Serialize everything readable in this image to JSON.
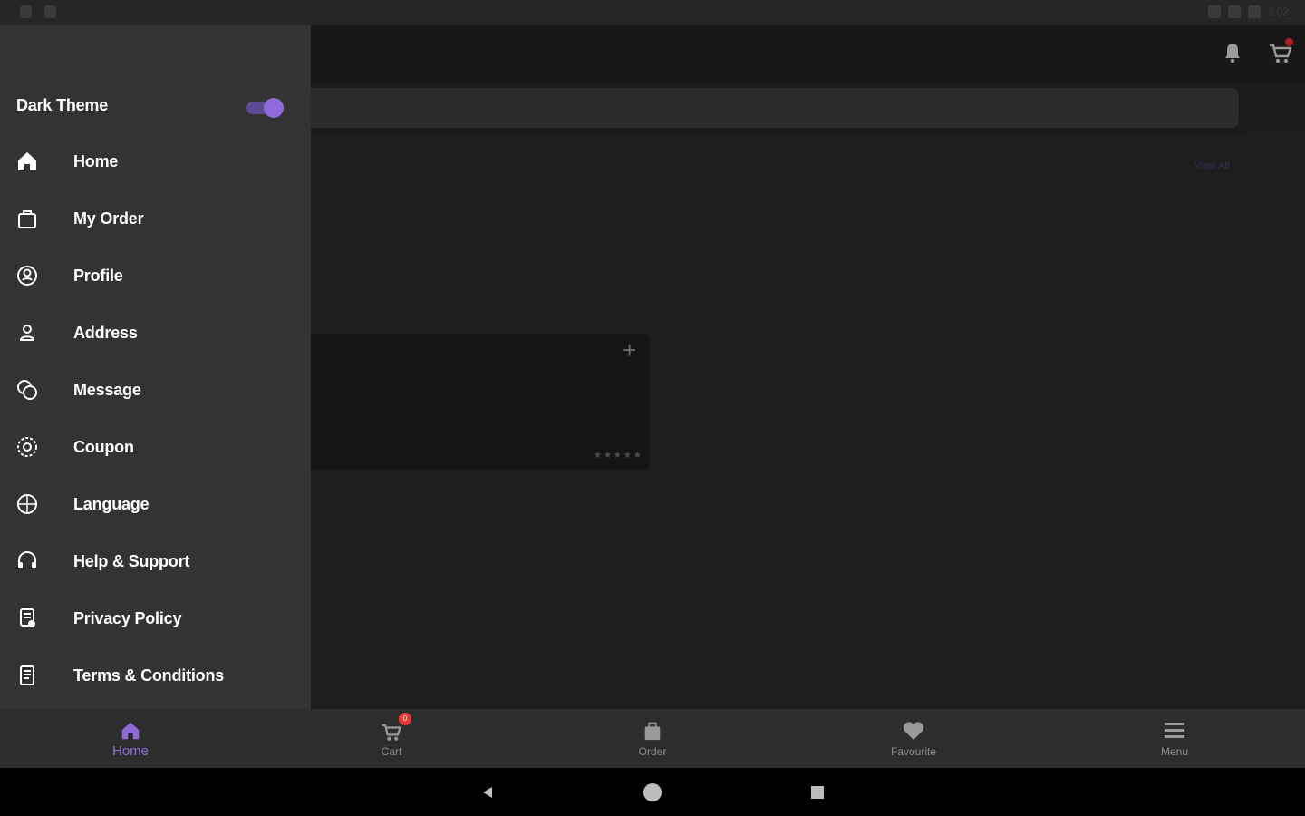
{
  "status_bar": {
    "time": "3:02"
  },
  "colors": {
    "accent": "#8e6bd9",
    "drawer_bg": "#333334",
    "page_bg": "#1e1e1f",
    "badge": "#e53935"
  },
  "header": {
    "icons": [
      "bell-icon",
      "cart-icon"
    ]
  },
  "home": {
    "view_all": "View All",
    "card_add": "+",
    "rating": "★★★★★"
  },
  "drawer": {
    "dark_theme_label": "Dark Theme",
    "dark_theme_enabled": true,
    "items": [
      {
        "label": "Home",
        "icon": "home-icon"
      },
      {
        "label": "My Order",
        "icon": "bag-icon"
      },
      {
        "label": "Profile",
        "icon": "profile-icon"
      },
      {
        "label": "Address",
        "icon": "address-icon"
      },
      {
        "label": "Message",
        "icon": "message-icon"
      },
      {
        "label": "Coupon",
        "icon": "coupon-icon"
      },
      {
        "label": "Language",
        "icon": "language-icon"
      },
      {
        "label": "Help & Support",
        "icon": "headset-icon"
      },
      {
        "label": "Privacy Policy",
        "icon": "privacy-icon"
      },
      {
        "label": "Terms & Conditions",
        "icon": "document-icon"
      }
    ]
  },
  "bottom_nav": {
    "items": [
      {
        "label": "Home",
        "icon": "home-icon",
        "active": true
      },
      {
        "label": "Cart",
        "icon": "cart-icon",
        "badge": "0"
      },
      {
        "label": "Order",
        "icon": "bag-icon"
      },
      {
        "label": "Favourite",
        "icon": "heart-icon"
      },
      {
        "label": "Menu",
        "icon": "menu-icon"
      }
    ]
  },
  "system_nav": [
    "back-icon",
    "home-circle-icon",
    "recents-icon"
  ]
}
